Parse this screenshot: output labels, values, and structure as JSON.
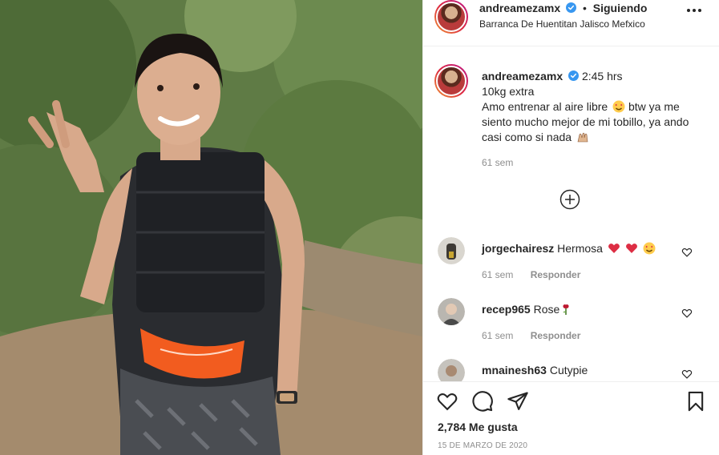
{
  "post": {
    "username": "andreamezamx",
    "separator": "•",
    "follow_state": "Siguiendo",
    "location": "Barranca De Huentitan Jalisco Mefxico"
  },
  "caption": {
    "username": "andreamezamx",
    "time": "2:45 hrs",
    "line1": "10kg extra",
    "line2": "Amo entrenar al aire libre",
    "line3": "btw ya me siento mucho mejor de mi tobillo, ya ando casi como si nada",
    "age": "61 sem"
  },
  "comments": [
    {
      "username": "jorgechairesz",
      "text": "Hermosa",
      "age": "61 sem",
      "reply": "Responder",
      "emoji": [
        "heart",
        "heart",
        "heart-eyes"
      ]
    },
    {
      "username": "recep965",
      "text": "Rose",
      "age": "61 sem",
      "reply": "Responder",
      "emoji": [
        "rose"
      ]
    },
    {
      "username": "mnainesh63",
      "text": "Cutypie"
    }
  ],
  "footer": {
    "likes": "2,784 Me gusta",
    "date": "15 DE MARZO DE 2020"
  },
  "icons": {
    "verified": "verified-badge-icon",
    "more": "more-options-icon",
    "load_more": "plus-circle-icon",
    "like": "heart-icon",
    "comment": "comment-icon",
    "share": "send-icon",
    "save": "bookmark-icon"
  },
  "colors": {
    "verified": "#3897f0",
    "heart": "#ed4956",
    "muted": "#8e8e8e"
  }
}
